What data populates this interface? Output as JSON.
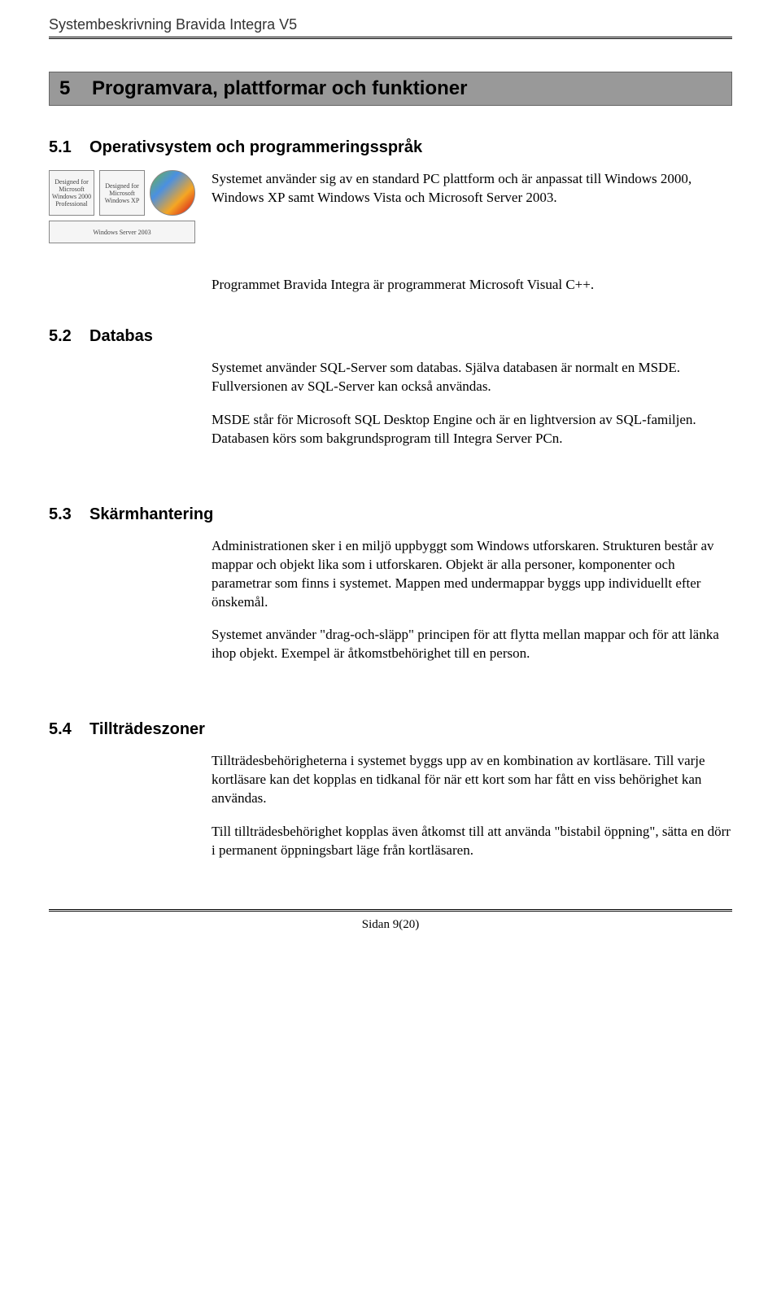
{
  "header": {
    "title": "Systembeskrivning Bravida Integra V5"
  },
  "chapter": {
    "number": "5",
    "title": "Programvara, plattformar och funktioner"
  },
  "sections": {
    "s51": {
      "number": "5.1",
      "title": "Operativsystem och programmeringsspråk",
      "p1": "Systemet använder sig av en standard PC plattform och är anpassat till Windows 2000, Windows XP samt Windows Vista och Microsoft Server 2003.",
      "p2": "Programmet Bravida Integra är programmerat Microsoft Visual C++."
    },
    "s52": {
      "number": "5.2",
      "title": "Databas",
      "p1": "Systemet använder SQL-Server som databas. Själva databasen är normalt en MSDE. Fullversionen av SQL-Server kan också användas.",
      "p2": "MSDE står för Microsoft SQL Desktop Engine och är en lightversion av SQL-familjen. Databasen körs som bakgrundsprogram till Integra Server PCn."
    },
    "s53": {
      "number": "5.3",
      "title": "Skärmhantering",
      "p1": "Administrationen sker i en miljö uppbyggt som Windows utforskaren. Strukturen består av mappar och objekt lika som i utforskaren. Objekt är alla personer, komponenter och parametrar som finns i systemet. Mappen med undermappar byggs upp individuellt efter önskemål.",
      "p2": "Systemet använder \"drag-och-släpp\" principen för att flytta mellan mappar och för att länka ihop objekt. Exempel är åtkomstbehörighet till en person."
    },
    "s54": {
      "number": "5.4",
      "title": "Tillträdeszoner",
      "p1": "Tillträdesbehörigheterna i systemet byggs upp av en kombination av kortläsare. Till varje kortläsare kan det kopplas en tidkanal för när ett kort som har fått en viss behörighet kan användas.",
      "p2": "Till tillträdesbehörighet kopplas även åtkomst till att använda \"bistabil öppning\", sätta en dörr i permanent öppningsbart läge från kortläsaren."
    }
  },
  "logos": {
    "win2000": "Designed for Microsoft Windows 2000 Professional",
    "winxp": "Designed for Microsoft Windows XP",
    "vista": "",
    "server": "Windows Server 2003"
  },
  "footer": {
    "page": "Sidan 9(20)"
  }
}
